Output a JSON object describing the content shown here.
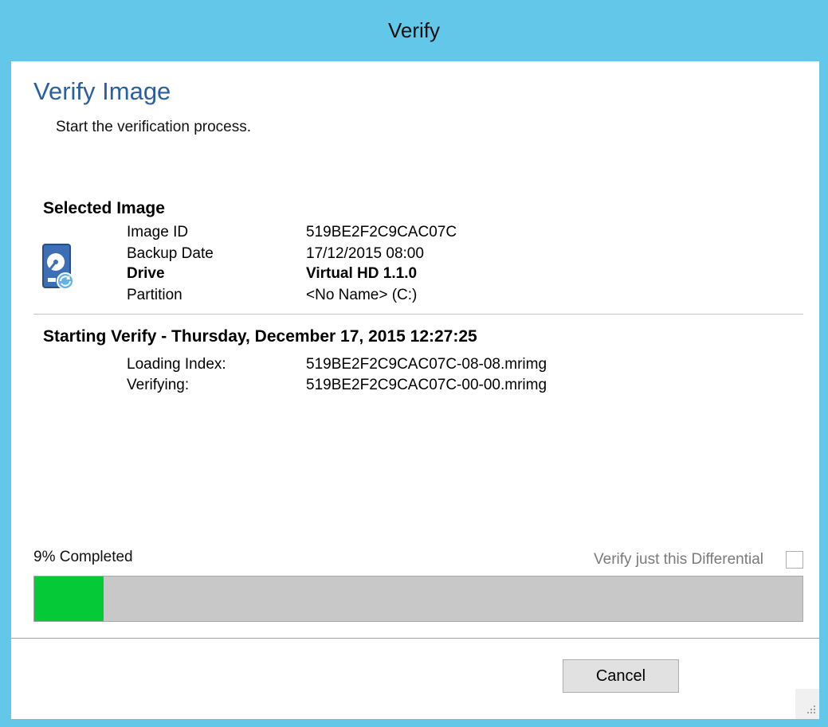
{
  "window": {
    "title": "Verify"
  },
  "header": {
    "title": "Verify Image",
    "subtitle": "Start the verification process."
  },
  "selected_image": {
    "title": "Selected Image",
    "icon": "hard-drive-restore-icon",
    "rows": [
      {
        "label": "Image ID",
        "value": "519BE2F2C9CAC07C",
        "bold": false
      },
      {
        "label": "Backup Date",
        "value": "17/12/2015 08:00",
        "bold": false
      },
      {
        "label": "Drive",
        "value": "Virtual HD 1.1.0",
        "bold": true
      },
      {
        "label": "Partition",
        "value": "<No Name> (C:)",
        "bold": false
      }
    ]
  },
  "verify_log": {
    "title": "Starting Verify - Thursday, December 17, 2015 12:27:25",
    "rows": [
      {
        "label": "Loading Index:",
        "value": "519BE2F2C9CAC07C-08-08.mrimg"
      },
      {
        "label": "Verifying:",
        "value": "519BE2F2C9CAC07C-00-00.mrimg"
      }
    ]
  },
  "progress": {
    "label": "9% Completed",
    "percent": 9,
    "fill_color": "#06c937",
    "differential_label": "Verify just this Differential",
    "differential_checked": false
  },
  "footer": {
    "cancel_label": "Cancel"
  },
  "colors": {
    "titlebar": "#63c7ea",
    "heading": "#2a5fa0"
  }
}
